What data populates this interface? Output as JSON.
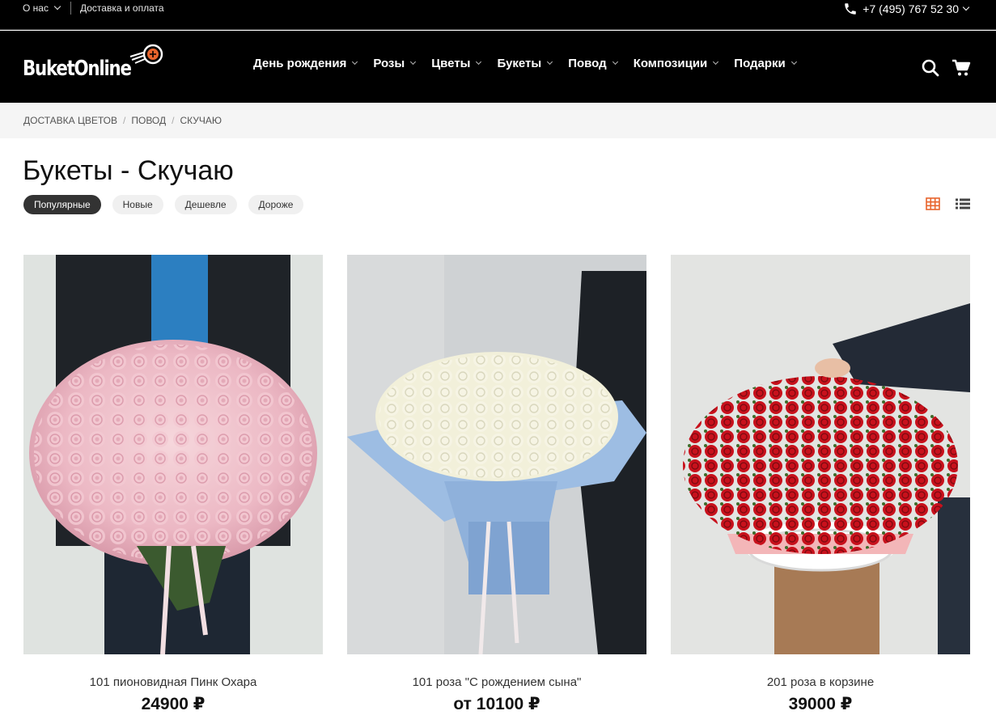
{
  "topbar": {
    "about": "О нас",
    "delivery": "Доставка и оплата",
    "phone": "+7 (495) 767 52 30"
  },
  "header": {
    "logo_text": "BuketOnline",
    "nav": [
      "День рождения",
      "Розы",
      "Цветы",
      "Букеты",
      "Повод",
      "Композиции",
      "Подарки"
    ]
  },
  "breadcrumb": [
    "ДОСТАВКА ЦВЕТОВ",
    "ПОВОД",
    "СКУЧАЮ"
  ],
  "page": {
    "title": "Букеты - Скучаю",
    "sort": [
      "Популярные",
      "Новые",
      "Дешевле",
      "Дороже"
    ],
    "active_sort": "Популярные"
  },
  "colors": {
    "accent": "#e8642c",
    "header_bg": "#000000",
    "pill_active": "#333333"
  },
  "products": [
    {
      "name": "101 пионовидная Пинк Охара",
      "price": "24900 ₽"
    },
    {
      "name": "101 роза \"С рождением сына\"",
      "price": "от 10100 ₽"
    },
    {
      "name": "201 роза в корзине",
      "price": "39000 ₽"
    }
  ]
}
